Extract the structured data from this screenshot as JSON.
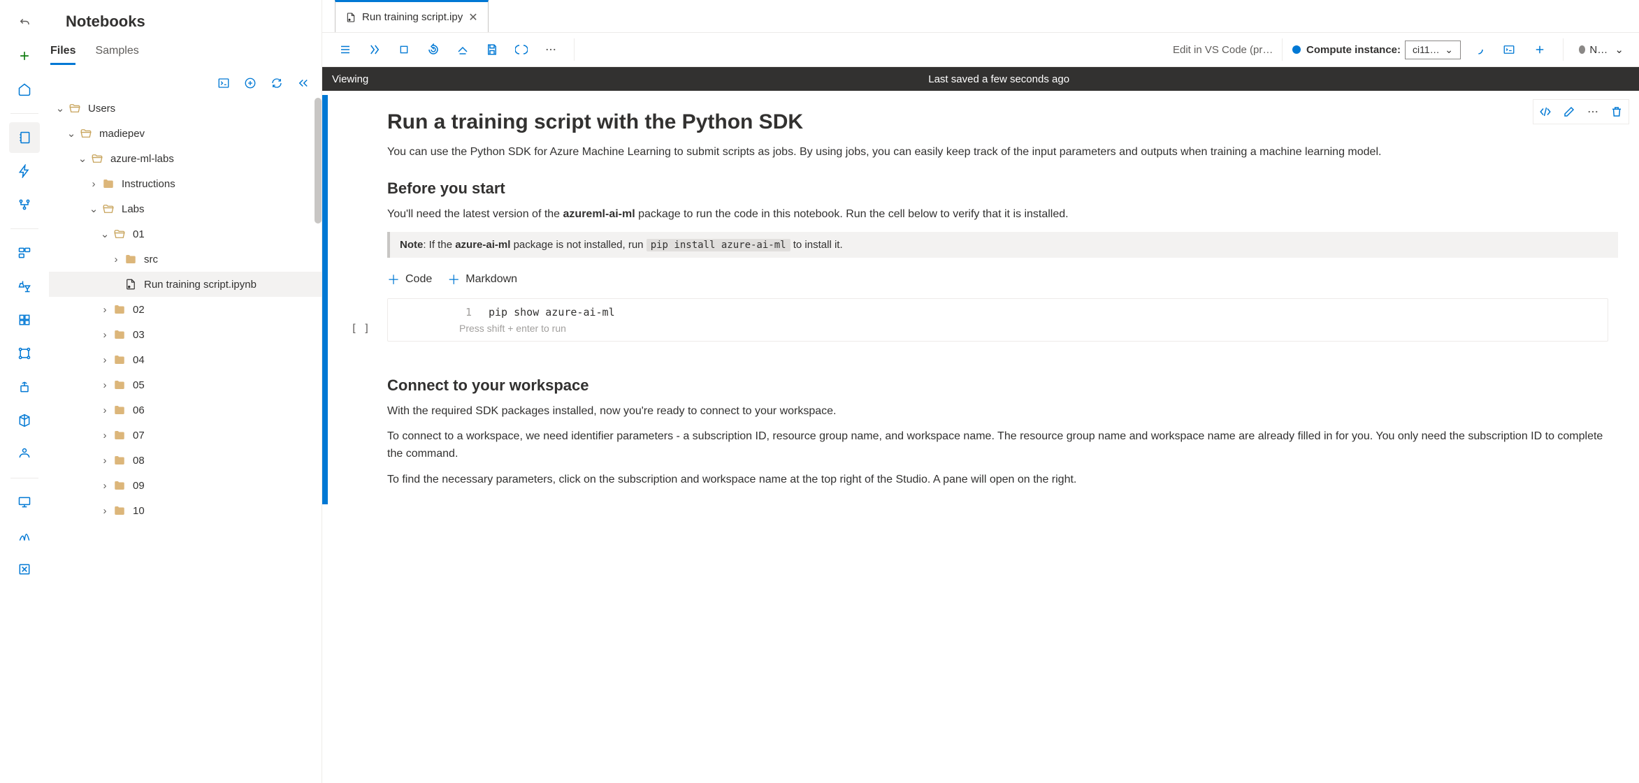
{
  "explorer": {
    "title": "Notebooks",
    "tabs": [
      {
        "label": "Files",
        "active": true
      },
      {
        "label": "Samples",
        "active": false
      }
    ]
  },
  "tree": {
    "users": "Users",
    "user": "madiepev",
    "repo": "azure-ml-labs",
    "instructions": "Instructions",
    "labs": "Labs",
    "lab01": "01",
    "src": "src",
    "notebook": "Run training script.ipynb",
    "folders": [
      "02",
      "03",
      "04",
      "05",
      "06",
      "07",
      "08",
      "09",
      "10"
    ]
  },
  "tabbar": {
    "name": "Run training script.ipy"
  },
  "toolbar": {
    "vscode": "Edit in VS Code (pr…",
    "compute_label": "Compute instance:",
    "compute_value": "ci11…",
    "kernel_label": "No …"
  },
  "status": {
    "mode": "Viewing",
    "saved": "Last saved a few seconds ago"
  },
  "content": {
    "h1": "Run a training script with the Python SDK",
    "p1": "You can use the Python SDK for Azure Machine Learning to submit scripts as jobs. By using jobs, you can easily keep track of the input parameters and outputs when training a machine learning model.",
    "h2a": "Before you start",
    "p2_pre": "You'll need the latest version of the ",
    "p2_bold": "azureml-ai-ml",
    "p2_post": " package to run the code in this notebook. Run the cell below to verify that it is installed.",
    "note_bold": "Note",
    "note_text": ": If the ",
    "note_bold2": "azure-ai-ml",
    "note_text2": " package is not installed, run ",
    "note_code": "pip install azure-ai-ml",
    "note_text3": " to install it.",
    "add_code": "Code",
    "add_md": "Markdown",
    "code_line": "pip show azure-ai-ml",
    "code_hint": "Press shift + enter to run",
    "prompt": "[ ]",
    "h2b": "Connect to your workspace",
    "p3": "With the required SDK packages installed, now you're ready to connect to your workspace.",
    "p4": "To connect to a workspace, we need identifier parameters - a subscription ID, resource group name, and workspace name. The resource group name and workspace name are already filled in for you. You only need the subscription ID to complete the command.",
    "p5": "To find the necessary parameters, click on the subscription and workspace name at the top right of the Studio. A pane will open on the right."
  }
}
